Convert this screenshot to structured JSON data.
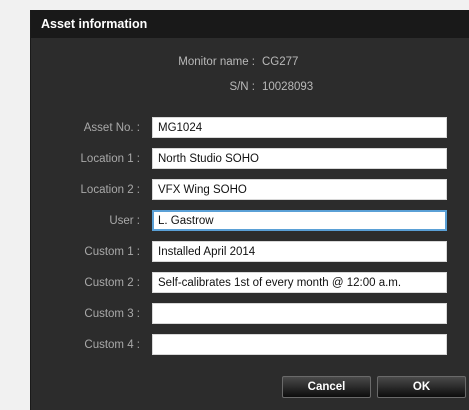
{
  "dialog": {
    "title": "Asset information",
    "monitor": {
      "name_label": "Monitor name :",
      "name_value": "CG277",
      "sn_label": "S/N :",
      "sn_value": "10028093"
    },
    "fields": [
      {
        "label": "Asset No. :",
        "value": "MG1024"
      },
      {
        "label": "Location 1 :",
        "value": "North Studio SOHO"
      },
      {
        "label": "Location 2 :",
        "value": "VFX Wing SOHO"
      },
      {
        "label": "User :",
        "value": "L. Gastrow"
      },
      {
        "label": "Custom 1 :",
        "value": "Installed April 2014"
      },
      {
        "label": "Custom 2 :",
        "value": "Self-calibrates 1st of every month @ 12:00 a.m."
      },
      {
        "label": "Custom 3 :",
        "value": ""
      },
      {
        "label": "Custom 4 :",
        "value": ""
      }
    ],
    "cancel_label": "Cancel",
    "ok_label": "OK"
  }
}
